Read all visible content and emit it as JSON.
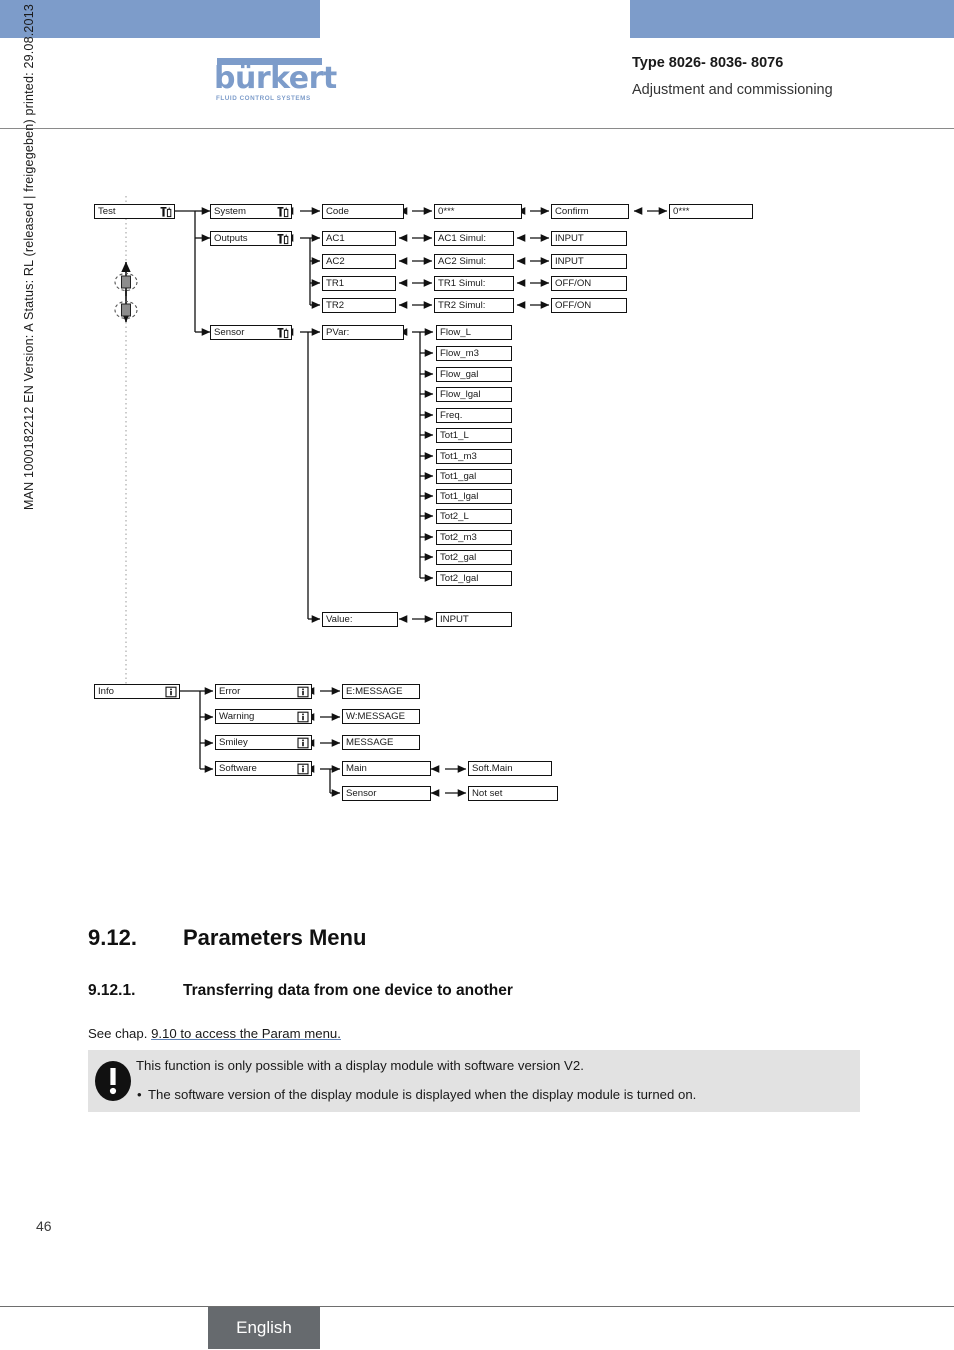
{
  "header": {
    "type_line": "Type 8026- 8036- 8076",
    "subtitle": "Adjustment and commissioning",
    "logo_word": "bürkert",
    "logo_tagline": "FLUID CONTROL SYSTEMS",
    "brand_color": "#7d9cca"
  },
  "margin_note": "MAN 1000182212  EN  Version: A  Status: RL (released | freigegeben)  printed: 29.08.2013",
  "diagram": {
    "test_menu": {
      "root": "Test",
      "branches": [
        {
          "level1": "System",
          "level2": "Code",
          "level3": "0***",
          "level4": "Confirm",
          "level5": "0***"
        },
        {
          "level1": "Outputs",
          "items": [
            {
              "name": "AC1",
              "simul": "AC1 Simul:",
              "value": "INPUT"
            },
            {
              "name": "AC2",
              "simul": "AC2 Simul:",
              "value": "INPUT"
            },
            {
              "name": "TR1",
              "simul": "TR1 Simul:",
              "value": "OFF/ON"
            },
            {
              "name": "TR2",
              "simul": "TR2 Simul:",
              "value": "OFF/ON"
            }
          ]
        },
        {
          "level1": "Sensor",
          "pvar_label": "PVar:",
          "pvar_options": [
            "Flow_L",
            "Flow_m3",
            "Flow_gal",
            "Flow_lgal",
            "Freq.",
            "Tot1_L",
            "Tot1_m3",
            "Tot1_gal",
            "Tot1_lgal",
            "Tot2_L",
            "Tot2_m3",
            "Tot2_gal",
            "Tot2_lgal"
          ],
          "value_label": "Value:",
          "value_input": "INPUT"
        }
      ]
    },
    "info_menu": {
      "root": "Info",
      "items": [
        {
          "name": "Error",
          "message": "E:MESSAGE"
        },
        {
          "name": "Warning",
          "message": "W:MESSAGE"
        },
        {
          "name": "Smiley",
          "message": "MESSAGE"
        },
        {
          "name": "Software",
          "sub": [
            {
              "name": "Main",
              "value": "Soft.Main"
            },
            {
              "name": "Sensor",
              "value": "Not set"
            }
          ]
        }
      ]
    }
  },
  "content": {
    "section_number": "9.12.",
    "section_title": "Parameters Menu",
    "subsection_number": "9.12.1.",
    "subsection_title": "Transferring data from one device to another",
    "see_chapter_prefix": "See chap. ",
    "see_chapter_link": "9.10 to access the Param menu.",
    "note_line1": "This function is only possible with a display module with software version V2.",
    "note_bullet": "•",
    "note_line2": "The software version of the display module is displayed when the display module is turned on."
  },
  "footer": {
    "page_number": "46",
    "language": "English"
  }
}
